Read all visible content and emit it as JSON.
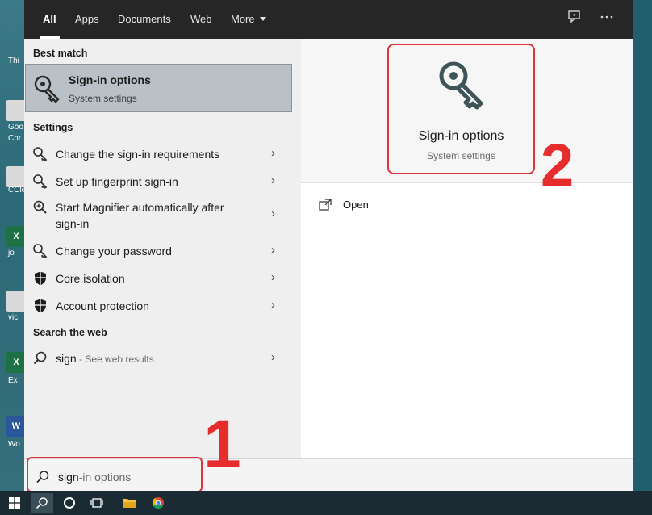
{
  "desktop": {
    "labels": [
      "Thi",
      "Goo",
      "Chr",
      "CCle",
      "jo",
      "vic",
      "Ex",
      "Wo"
    ]
  },
  "tabs": [
    {
      "label": "All"
    },
    {
      "label": "Apps"
    },
    {
      "label": "Documents"
    },
    {
      "label": "Web"
    },
    {
      "label": "More"
    }
  ],
  "topbar_icons": [
    "feedback-icon",
    "more-options-icon"
  ],
  "sections": {
    "best_match": "Best match",
    "settings": "Settings",
    "search_web": "Search the web"
  },
  "best_match": {
    "title": "Sign-in options",
    "subtitle": "System settings"
  },
  "settings_items": [
    {
      "label": "Change the sign-in requirements",
      "icon": "search-key-icon"
    },
    {
      "label": "Set up fingerprint sign-in",
      "icon": "search-key-icon"
    },
    {
      "label_line1": "Start Magnifier automatically after",
      "label_line2": "sign-in",
      "icon": "magnifier-icon"
    },
    {
      "label": "Change your password",
      "icon": "search-key-icon"
    },
    {
      "label": "Core isolation",
      "icon": "shield-icon"
    },
    {
      "label": "Account protection",
      "icon": "shield-icon"
    }
  ],
  "web_item": {
    "query": "sign",
    "hint": " - See web results"
  },
  "preview": {
    "title": "Sign-in options",
    "subtitle": "System settings",
    "action": "Open"
  },
  "search": {
    "typed": "sign",
    "suggested": "-in options"
  },
  "annotations": {
    "one": "1",
    "two": "2"
  },
  "colors": {
    "highlight_red": "#e0333a",
    "topbar": "#262626",
    "selected_row": "#b9c1c6"
  }
}
